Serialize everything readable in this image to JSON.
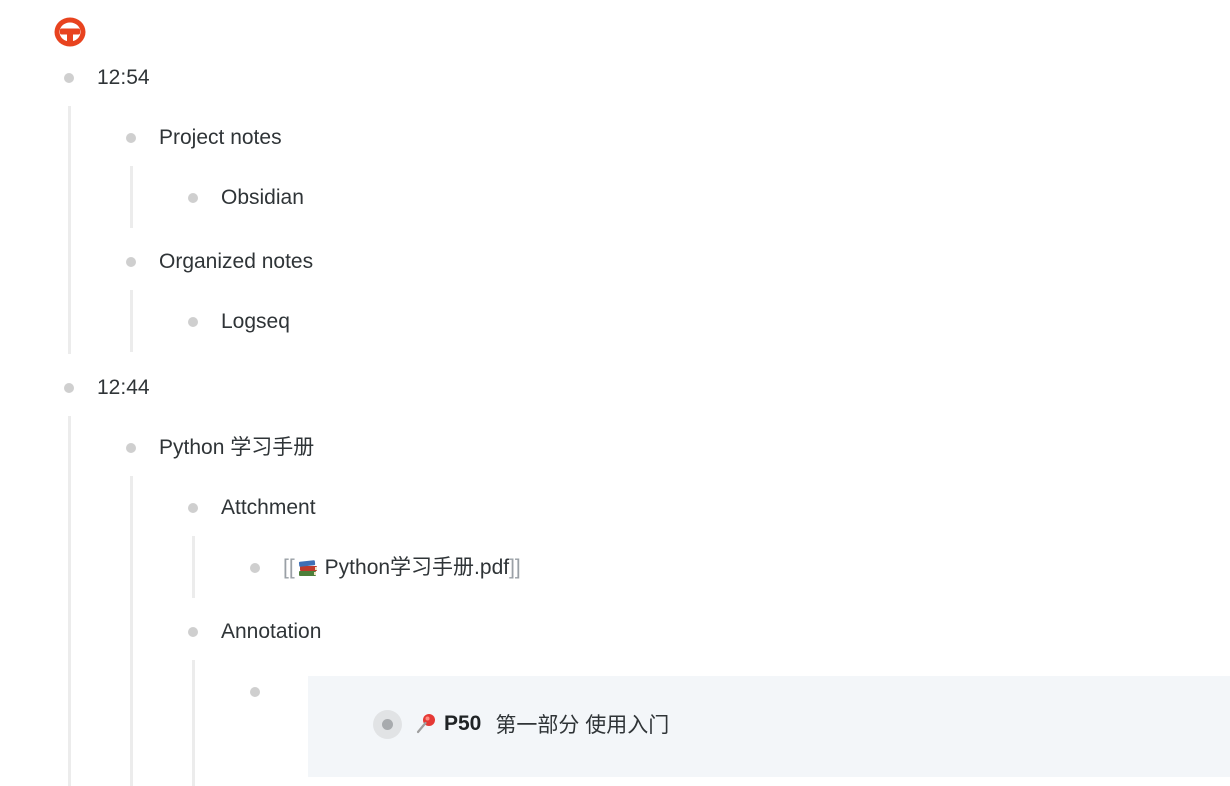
{
  "outline": {
    "blocks": [
      {
        "id": "b1",
        "text": "12:54"
      },
      {
        "id": "b2",
        "text": "Project notes"
      },
      {
        "id": "b3",
        "text": "Obsidian"
      },
      {
        "id": "b4",
        "text": "Organized notes"
      },
      {
        "id": "b5",
        "text": "Logseq"
      },
      {
        "id": "b6",
        "text": "12:44"
      },
      {
        "id": "b7",
        "text": "Python 学习手册"
      },
      {
        "id": "b8",
        "text": "Attchment"
      },
      {
        "id": "b9",
        "open": "[[",
        "text": "Python学习手册.pdf",
        "close": "]]",
        "icon": "books-icon"
      },
      {
        "id": "b10",
        "text": "Annotation"
      }
    ]
  },
  "annotation": {
    "icon": "pushpin-icon",
    "page": "P50",
    "text": "第一部分 使用入门"
  },
  "colors": {
    "logo": "#e8431f",
    "bullet": "#cfcfcf",
    "guide": "#ececec",
    "highlight_bg": "#f3f6f9",
    "text": "#2f3437"
  }
}
